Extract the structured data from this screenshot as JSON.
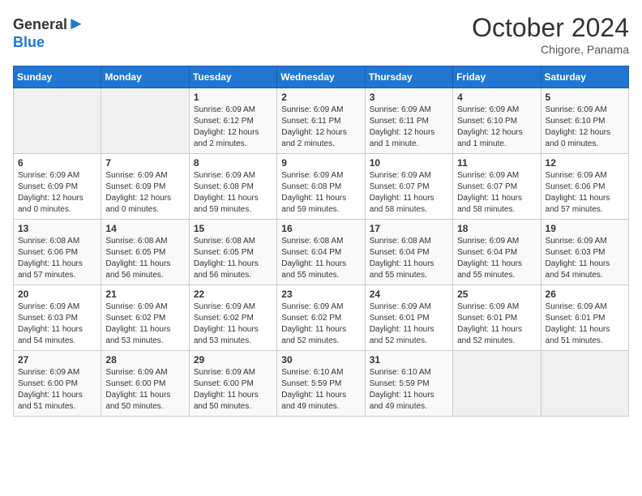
{
  "header": {
    "logo": {
      "general": "General",
      "blue": "Blue"
    },
    "title": "October 2024",
    "location": "Chigore, Panama"
  },
  "calendar": {
    "weekdays": [
      "Sunday",
      "Monday",
      "Tuesday",
      "Wednesday",
      "Thursday",
      "Friday",
      "Saturday"
    ],
    "weeks": [
      [
        {
          "day": "",
          "info": ""
        },
        {
          "day": "",
          "info": ""
        },
        {
          "day": "1",
          "info": "Sunrise: 6:09 AM\nSunset: 6:12 PM\nDaylight: 12 hours and 2 minutes."
        },
        {
          "day": "2",
          "info": "Sunrise: 6:09 AM\nSunset: 6:11 PM\nDaylight: 12 hours and 2 minutes."
        },
        {
          "day": "3",
          "info": "Sunrise: 6:09 AM\nSunset: 6:11 PM\nDaylight: 12 hours and 1 minute."
        },
        {
          "day": "4",
          "info": "Sunrise: 6:09 AM\nSunset: 6:10 PM\nDaylight: 12 hours and 1 minute."
        },
        {
          "day": "5",
          "info": "Sunrise: 6:09 AM\nSunset: 6:10 PM\nDaylight: 12 hours and 0 minutes."
        }
      ],
      [
        {
          "day": "6",
          "info": "Sunrise: 6:09 AM\nSunset: 6:09 PM\nDaylight: 12 hours and 0 minutes."
        },
        {
          "day": "7",
          "info": "Sunrise: 6:09 AM\nSunset: 6:09 PM\nDaylight: 12 hours and 0 minutes."
        },
        {
          "day": "8",
          "info": "Sunrise: 6:09 AM\nSunset: 6:08 PM\nDaylight: 11 hours and 59 minutes."
        },
        {
          "day": "9",
          "info": "Sunrise: 6:09 AM\nSunset: 6:08 PM\nDaylight: 11 hours and 59 minutes."
        },
        {
          "day": "10",
          "info": "Sunrise: 6:09 AM\nSunset: 6:07 PM\nDaylight: 11 hours and 58 minutes."
        },
        {
          "day": "11",
          "info": "Sunrise: 6:09 AM\nSunset: 6:07 PM\nDaylight: 11 hours and 58 minutes."
        },
        {
          "day": "12",
          "info": "Sunrise: 6:09 AM\nSunset: 6:06 PM\nDaylight: 11 hours and 57 minutes."
        }
      ],
      [
        {
          "day": "13",
          "info": "Sunrise: 6:08 AM\nSunset: 6:06 PM\nDaylight: 11 hours and 57 minutes."
        },
        {
          "day": "14",
          "info": "Sunrise: 6:08 AM\nSunset: 6:05 PM\nDaylight: 11 hours and 56 minutes."
        },
        {
          "day": "15",
          "info": "Sunrise: 6:08 AM\nSunset: 6:05 PM\nDaylight: 11 hours and 56 minutes."
        },
        {
          "day": "16",
          "info": "Sunrise: 6:08 AM\nSunset: 6:04 PM\nDaylight: 11 hours and 55 minutes."
        },
        {
          "day": "17",
          "info": "Sunrise: 6:08 AM\nSunset: 6:04 PM\nDaylight: 11 hours and 55 minutes."
        },
        {
          "day": "18",
          "info": "Sunrise: 6:09 AM\nSunset: 6:04 PM\nDaylight: 11 hours and 55 minutes."
        },
        {
          "day": "19",
          "info": "Sunrise: 6:09 AM\nSunset: 6:03 PM\nDaylight: 11 hours and 54 minutes."
        }
      ],
      [
        {
          "day": "20",
          "info": "Sunrise: 6:09 AM\nSunset: 6:03 PM\nDaylight: 11 hours and 54 minutes."
        },
        {
          "day": "21",
          "info": "Sunrise: 6:09 AM\nSunset: 6:02 PM\nDaylight: 11 hours and 53 minutes."
        },
        {
          "day": "22",
          "info": "Sunrise: 6:09 AM\nSunset: 6:02 PM\nDaylight: 11 hours and 53 minutes."
        },
        {
          "day": "23",
          "info": "Sunrise: 6:09 AM\nSunset: 6:02 PM\nDaylight: 11 hours and 52 minutes."
        },
        {
          "day": "24",
          "info": "Sunrise: 6:09 AM\nSunset: 6:01 PM\nDaylight: 11 hours and 52 minutes."
        },
        {
          "day": "25",
          "info": "Sunrise: 6:09 AM\nSunset: 6:01 PM\nDaylight: 11 hours and 52 minutes."
        },
        {
          "day": "26",
          "info": "Sunrise: 6:09 AM\nSunset: 6:01 PM\nDaylight: 11 hours and 51 minutes."
        }
      ],
      [
        {
          "day": "27",
          "info": "Sunrise: 6:09 AM\nSunset: 6:00 PM\nDaylight: 11 hours and 51 minutes."
        },
        {
          "day": "28",
          "info": "Sunrise: 6:09 AM\nSunset: 6:00 PM\nDaylight: 11 hours and 50 minutes."
        },
        {
          "day": "29",
          "info": "Sunrise: 6:09 AM\nSunset: 6:00 PM\nDaylight: 11 hours and 50 minutes."
        },
        {
          "day": "30",
          "info": "Sunrise: 6:10 AM\nSunset: 5:59 PM\nDaylight: 11 hours and 49 minutes."
        },
        {
          "day": "31",
          "info": "Sunrise: 6:10 AM\nSunset: 5:59 PM\nDaylight: 11 hours and 49 minutes."
        },
        {
          "day": "",
          "info": ""
        },
        {
          "day": "",
          "info": ""
        }
      ]
    ]
  }
}
